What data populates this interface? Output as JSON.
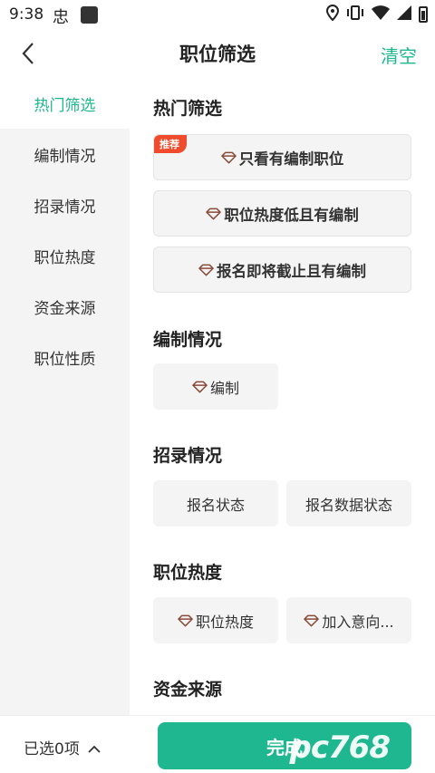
{
  "status_bar": {
    "time": "9:38",
    "bug_glyph": "忠"
  },
  "header": {
    "title": "职位筛选",
    "clear_label": "清空"
  },
  "sidebar": {
    "items": [
      {
        "label": "热门筛选",
        "active": true
      },
      {
        "label": "编制情况",
        "active": false
      },
      {
        "label": "招录情况",
        "active": false
      },
      {
        "label": "职位热度",
        "active": false
      },
      {
        "label": "资金来源",
        "active": false
      },
      {
        "label": "职位性质",
        "active": false
      }
    ]
  },
  "sections": {
    "hot": {
      "title": "热门筛选",
      "badge": "推荐",
      "options": [
        "只看有编制职位",
        "职位热度低且有编制",
        "报名即将截止且有编制"
      ]
    },
    "staffing": {
      "title": "编制情况",
      "options": [
        "编制"
      ]
    },
    "recruit": {
      "title": "招录情况",
      "options": [
        "报名状态",
        "报名数据状态"
      ]
    },
    "heat": {
      "title": "职位热度",
      "options": [
        "职位热度",
        "加入意向..."
      ]
    },
    "fund": {
      "title": "资金来源"
    }
  },
  "bottom": {
    "selected_label": "已选0项",
    "done_label": "完成",
    "watermark": "pc768"
  },
  "colors": {
    "accent": "#1fb78f",
    "badge": "#ef4b2c",
    "gem": "#8a4b3a"
  },
  "icons": {
    "back": "chevron-left-icon",
    "gem": "diamond-icon",
    "expand": "chevron-up-icon"
  }
}
